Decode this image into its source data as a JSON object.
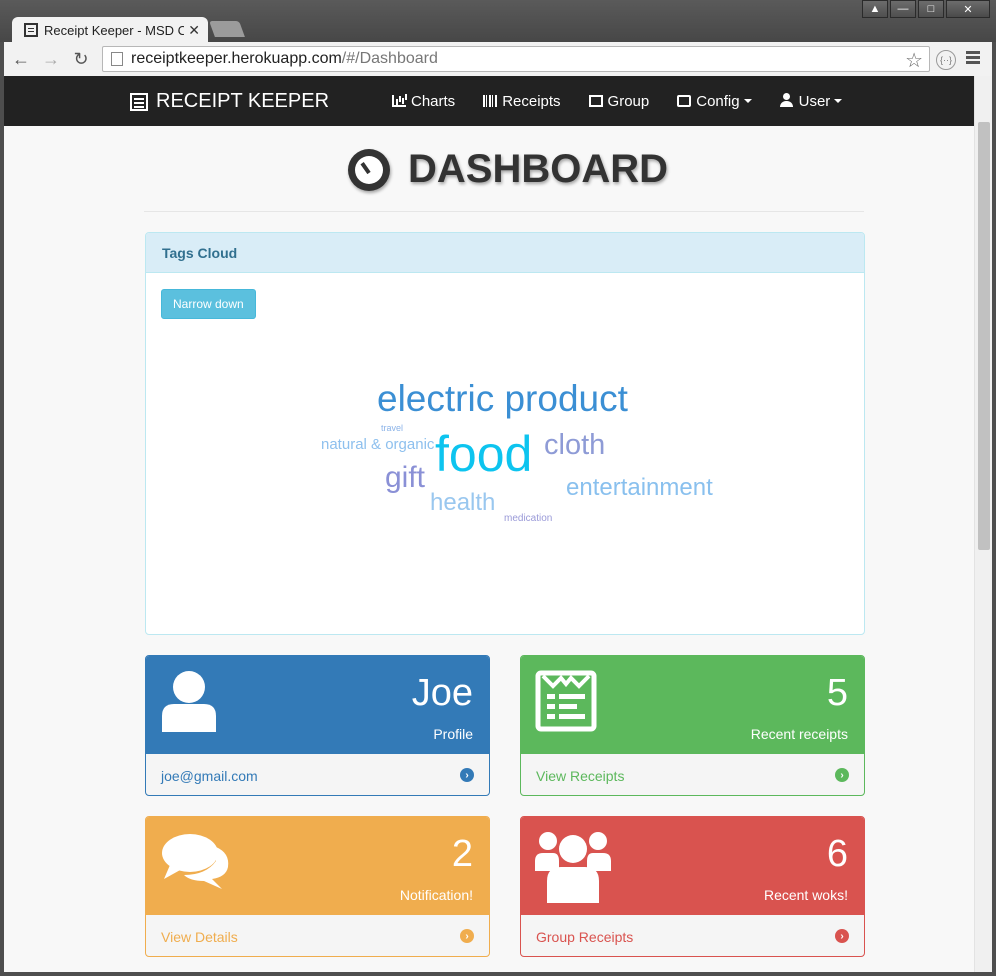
{
  "browser": {
    "tab_title": "Receipt Keeper - MSD C",
    "tab_close": "✕",
    "url_host": "receiptkeeper.herokuapp.com",
    "url_path": "/#/Dashboard",
    "ext_label": "{··}"
  },
  "navbar": {
    "brand": "RECEIPT KEEPER",
    "items": [
      {
        "label": "Charts",
        "icon": "bar-chart-icon"
      },
      {
        "label": "Receipts",
        "icon": "barcode-icon"
      },
      {
        "label": "Group",
        "icon": "group-icon"
      },
      {
        "label": "Config",
        "icon": "inbox-icon",
        "dropdown": true
      },
      {
        "label": "User",
        "icon": "user-icon",
        "dropdown": true
      }
    ]
  },
  "page": {
    "title": "DASHBOARD"
  },
  "tags_panel": {
    "heading": "Tags Cloud",
    "button": "Narrow down",
    "tags": [
      {
        "text": "electric product",
        "color": "#3b8fd4"
      },
      {
        "text": "travel",
        "color": "#8bb3e8"
      },
      {
        "text": "natural & organic",
        "color": "#8ec0ee"
      },
      {
        "text": "food",
        "color": "#0dc4ef"
      },
      {
        "text": "cloth",
        "color": "#8e9bd6"
      },
      {
        "text": "gift",
        "color": "#8a90d6"
      },
      {
        "text": "entertainment",
        "color": "#89c0ee"
      },
      {
        "text": "health",
        "color": "#99c7ef"
      },
      {
        "text": "medication",
        "color": "#9a9ad8"
      }
    ]
  },
  "cards": {
    "profile": {
      "value": "Joe",
      "caption": "Profile",
      "footer": "joe@gmail.com",
      "color": "#337ab7"
    },
    "receipts": {
      "value": "5",
      "caption": "Recent receipts",
      "footer": "View Receipts",
      "color": "#5cb85c"
    },
    "notifications": {
      "value": "2",
      "caption": "Notification!",
      "footer": "View Details",
      "color": "#f0ad4e"
    },
    "groups": {
      "value": "6",
      "caption": "Recent woks!",
      "footer": "Group Receipts",
      "color": "#d9534f"
    }
  }
}
